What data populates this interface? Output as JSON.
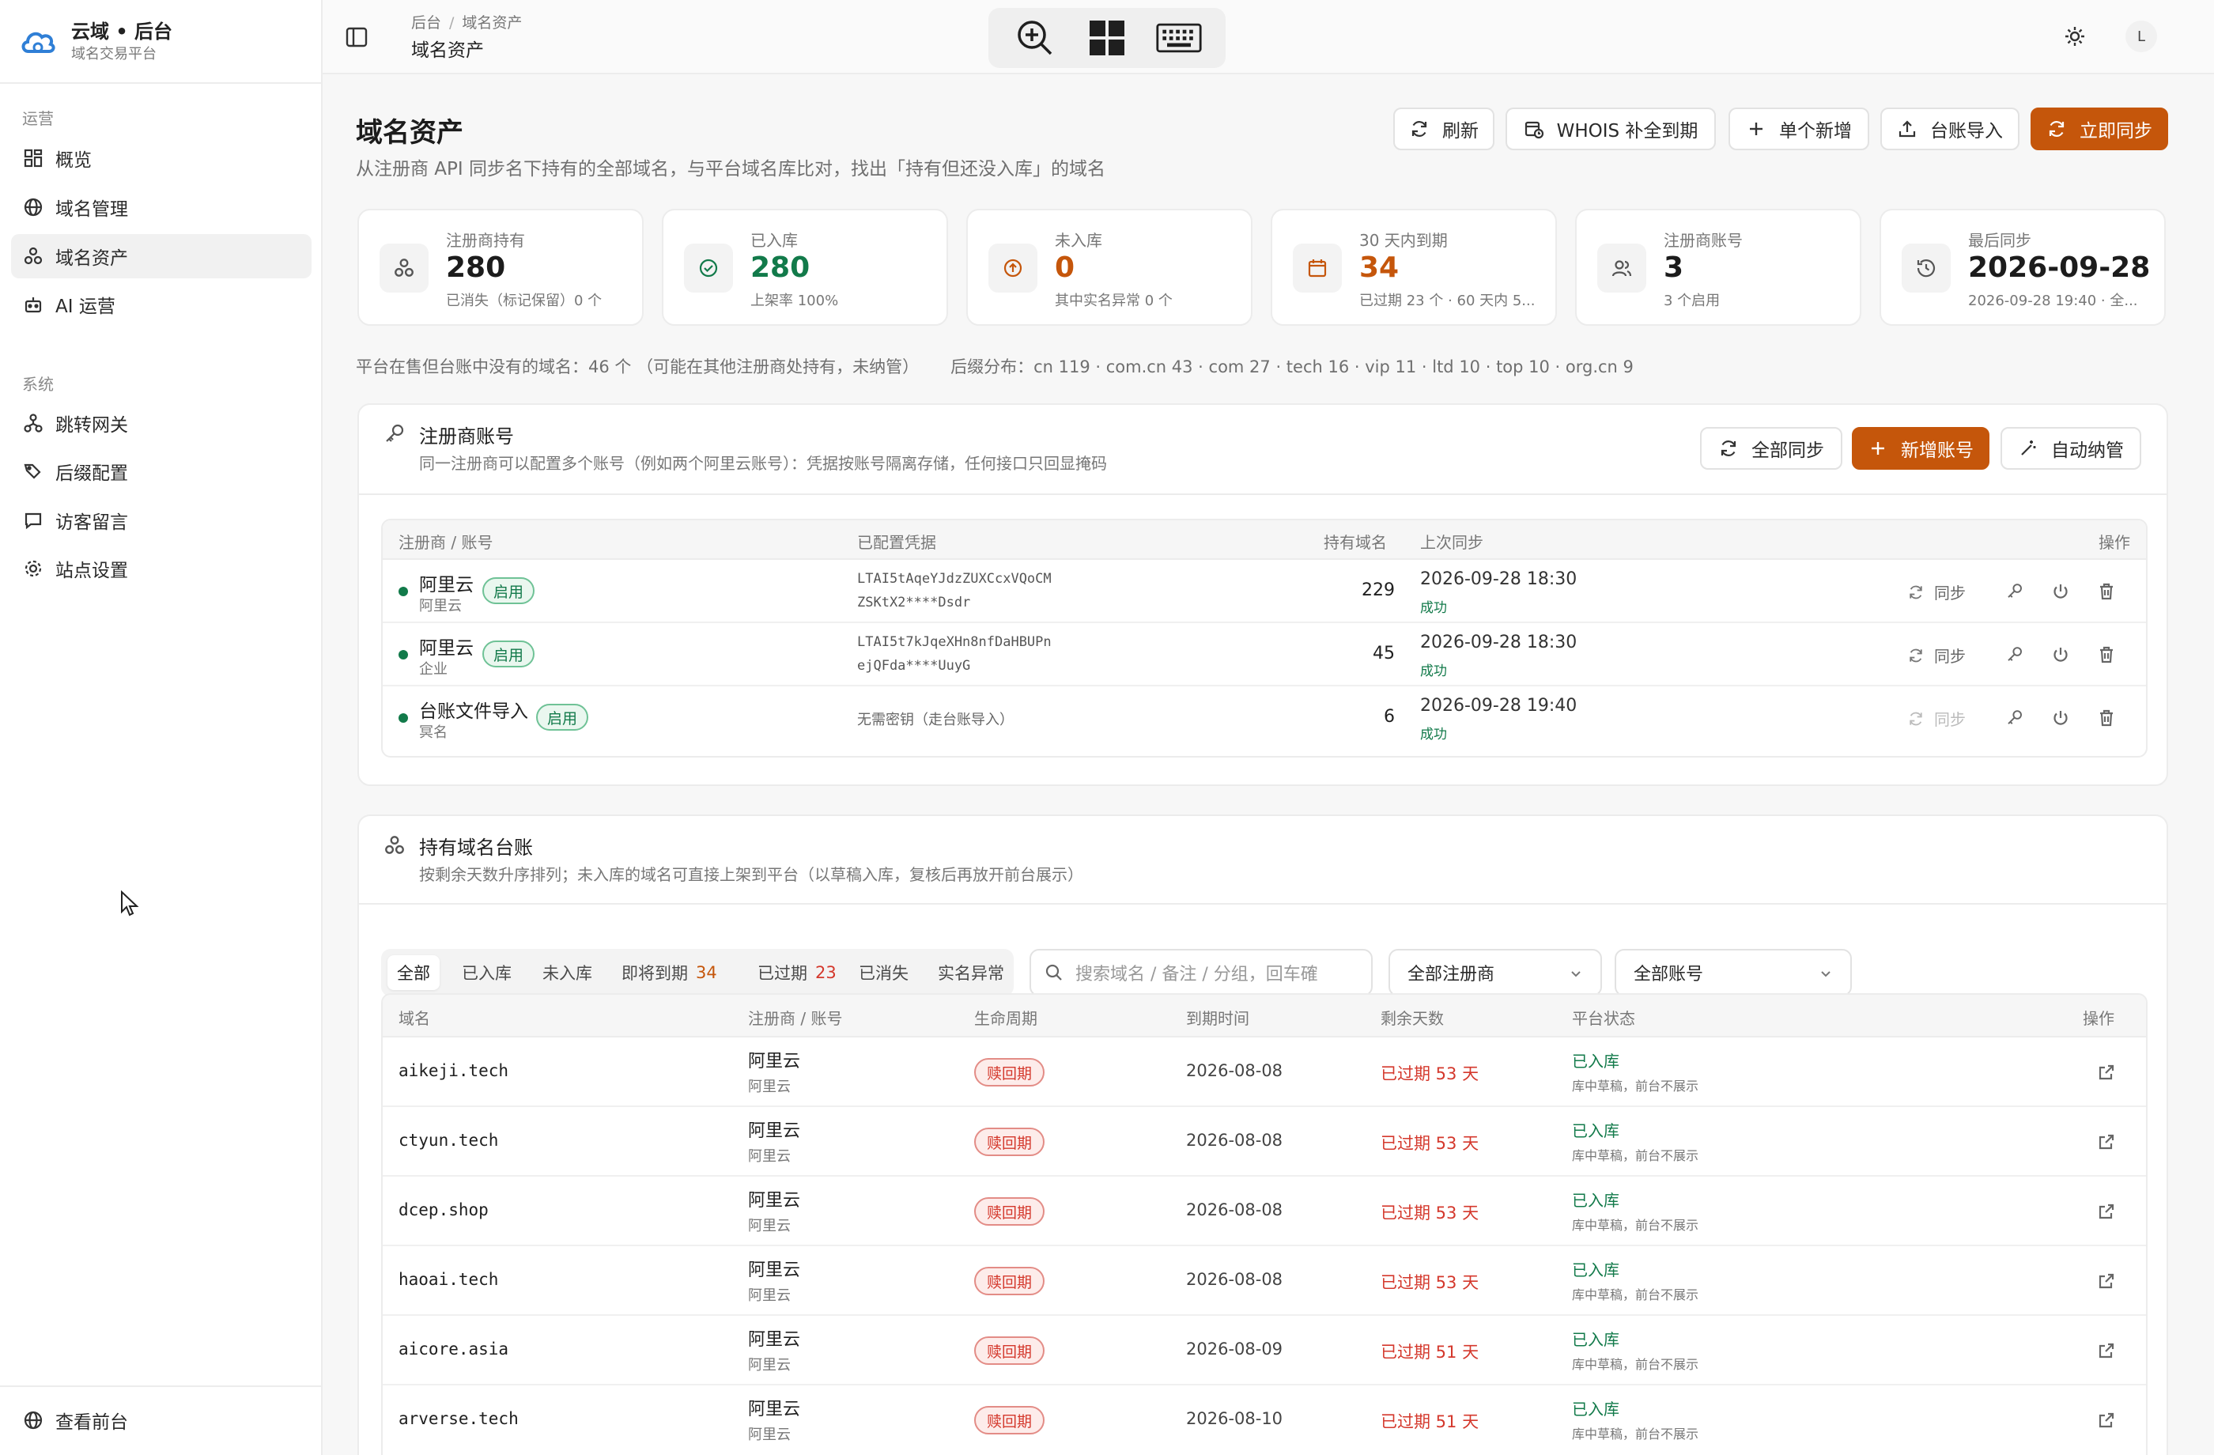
{
  "brand": {
    "title": "云域 • 后台",
    "subtitle": "域名交易平台"
  },
  "sidebar": {
    "group_ops": "运营",
    "group_sys": "系统",
    "items": [
      {
        "label": "概览",
        "icon": "dashboard-icon"
      },
      {
        "label": "域名管理",
        "icon": "globe-icon"
      },
      {
        "label": "域名资产",
        "icon": "assets-icon",
        "active": true
      },
      {
        "label": "AI 运营",
        "icon": "robot-icon"
      },
      {
        "label": "跳转网关",
        "icon": "gateway-icon"
      },
      {
        "label": "后缀配置",
        "icon": "tags-icon"
      },
      {
        "label": "访客留言",
        "icon": "message-icon"
      },
      {
        "label": "站点设置",
        "icon": "settings-icon"
      }
    ],
    "bottom_link": "查看前台"
  },
  "header": {
    "breadcrumb": [
      "后台",
      "域名资产"
    ],
    "title": "域名资产",
    "avatar_letter": "L"
  },
  "page": {
    "title": "域名资产",
    "description": "从注册商 API 同步名下持有的全部域名，与平台域名库比对，找出「持有但还没入库」的域名",
    "actions": {
      "refresh": "刷新",
      "whois": "WHOIS 补全到期",
      "add_single": "单个新增",
      "import": "台账导入",
      "sync_now": "立即同步"
    }
  },
  "stats": [
    {
      "label": "注册商持有",
      "value": "280",
      "sub": "已消失（标记保留）0 个",
      "icon": "assets-icon",
      "tone": "default"
    },
    {
      "label": "已入库",
      "value": "280",
      "sub": "上架率 100%",
      "icon": "check-circle-icon",
      "tone": "green"
    },
    {
      "label": "未入库",
      "value": "0",
      "sub": "其中实名异常 0 个",
      "icon": "arrow-up-circle-icon",
      "tone": "orange"
    },
    {
      "label": "30 天内到期",
      "value": "34",
      "sub": "已过期 23 个 · 60 天内 5...",
      "icon": "calendar-icon",
      "tone": "orange"
    },
    {
      "label": "注册商账号",
      "value": "3",
      "sub": "3 个启用",
      "icon": "users-icon",
      "tone": "default"
    },
    {
      "label": "最后同步",
      "value": "2026-09-28",
      "sub": "2026-09-28 19:40 · 全...",
      "icon": "history-icon",
      "tone": "default"
    }
  ],
  "info_line": {
    "left": "平台在售但台账中没有的域名：46 个 （可能在其他注册商处持有，未纳管）",
    "right": "后缀分布：cn 119 · com.cn 43 · com 27 · tech 16 · vip 11 · ltd 10 · top 10 · org.cn 9"
  },
  "registrar_panel": {
    "title": "注册商账号",
    "description": "同一注册商可以配置多个账号（例如两个阿里云账号）：凭据按账号隔离存储，任何接口只回显掩码",
    "actions": {
      "sync_all": "全部同步",
      "add_account": "新增账号",
      "auto_manage": "自动纳管"
    },
    "columns": [
      "注册商 / 账号",
      "已配置凭据",
      "持有域名",
      "上次同步",
      "操作"
    ],
    "sync_label": "同步",
    "rows": [
      {
        "name": "阿里云",
        "account": "阿里云",
        "status": "启用",
        "cred1": "LTAI5tAqeYJdzZUXCcxVQoCM",
        "cred2": "ZSKtX2****Dsdr",
        "count": "229",
        "last_sync": "2026-09-28 18:30",
        "result": "成功"
      },
      {
        "name": "阿里云",
        "account": "企业",
        "status": "启用",
        "cred1": "LTAI5t7kJqeXHn8nfDaHBUPn",
        "cred2": "ejQFda****UuyG",
        "count": "45",
        "last_sync": "2026-09-28 18:30",
        "result": "成功"
      },
      {
        "name": "台账文件导入",
        "account": "冥名",
        "status": "启用",
        "cred1": "无需密钥（走台账导入）",
        "cred2": "",
        "count": "6",
        "last_sync": "2026-09-28 19:40",
        "result": "成功"
      }
    ]
  },
  "ledger_panel": {
    "title": "持有域名台账",
    "description": "按剩余天数升序排列；未入库的域名可直接上架到平台（以草稿入库，复核后再放开前台展示）",
    "tabs": [
      {
        "label": "全部",
        "count": ""
      },
      {
        "label": "已入库",
        "count": ""
      },
      {
        "label": "未入库",
        "count": ""
      },
      {
        "label": "即将到期",
        "count": "34"
      },
      {
        "label": "已过期",
        "count": "23"
      },
      {
        "label": "已消失",
        "count": ""
      },
      {
        "label": "实名异常",
        "count": ""
      }
    ],
    "search_placeholder": "搜索域名 / 备注 / 分组，回车確",
    "registrar_select": "全部注册商",
    "account_select": "全部账号",
    "columns": [
      "域名",
      "注册商 / 账号",
      "生命周期",
      "到期时间",
      "剩余天数",
      "平台状态",
      "操作"
    ],
    "rows": [
      {
        "domain": "aikeji.tech",
        "registrar": "阿里云",
        "account": "阿里云",
        "lifecycle": "赎回期",
        "expiry": "2026-08-08",
        "remaining": "已过期 53 天",
        "status": "已入库",
        "status_sub": "库中草稿，前台不展示"
      },
      {
        "domain": "ctyun.tech",
        "registrar": "阿里云",
        "account": "阿里云",
        "lifecycle": "赎回期",
        "expiry": "2026-08-08",
        "remaining": "已过期 53 天",
        "status": "已入库",
        "status_sub": "库中草稿，前台不展示"
      },
      {
        "domain": "dcep.shop",
        "registrar": "阿里云",
        "account": "阿里云",
        "lifecycle": "赎回期",
        "expiry": "2026-08-08",
        "remaining": "已过期 53 天",
        "status": "已入库",
        "status_sub": "库中草稿，前台不展示"
      },
      {
        "domain": "haoai.tech",
        "registrar": "阿里云",
        "account": "阿里云",
        "lifecycle": "赎回期",
        "expiry": "2026-08-08",
        "remaining": "已过期 53 天",
        "status": "已入库",
        "status_sub": "库中草稿，前台不展示"
      },
      {
        "domain": "aicore.asia",
        "registrar": "阿里云",
        "account": "阿里云",
        "lifecycle": "赎回期",
        "expiry": "2026-08-09",
        "remaining": "已过期 51 天",
        "status": "已入库",
        "status_sub": "库中草稿，前台不展示"
      },
      {
        "domain": "arverse.tech",
        "registrar": "阿里云",
        "account": "阿里云",
        "lifecycle": "赎回期",
        "expiry": "2026-08-10",
        "remaining": "已过期 51 天",
        "status": "已入库",
        "status_sub": "库中草稿，前台不展示"
      }
    ]
  },
  "colors": {
    "accent": "#c5560b",
    "success": "#127a4a",
    "danger": "#d4382c"
  }
}
